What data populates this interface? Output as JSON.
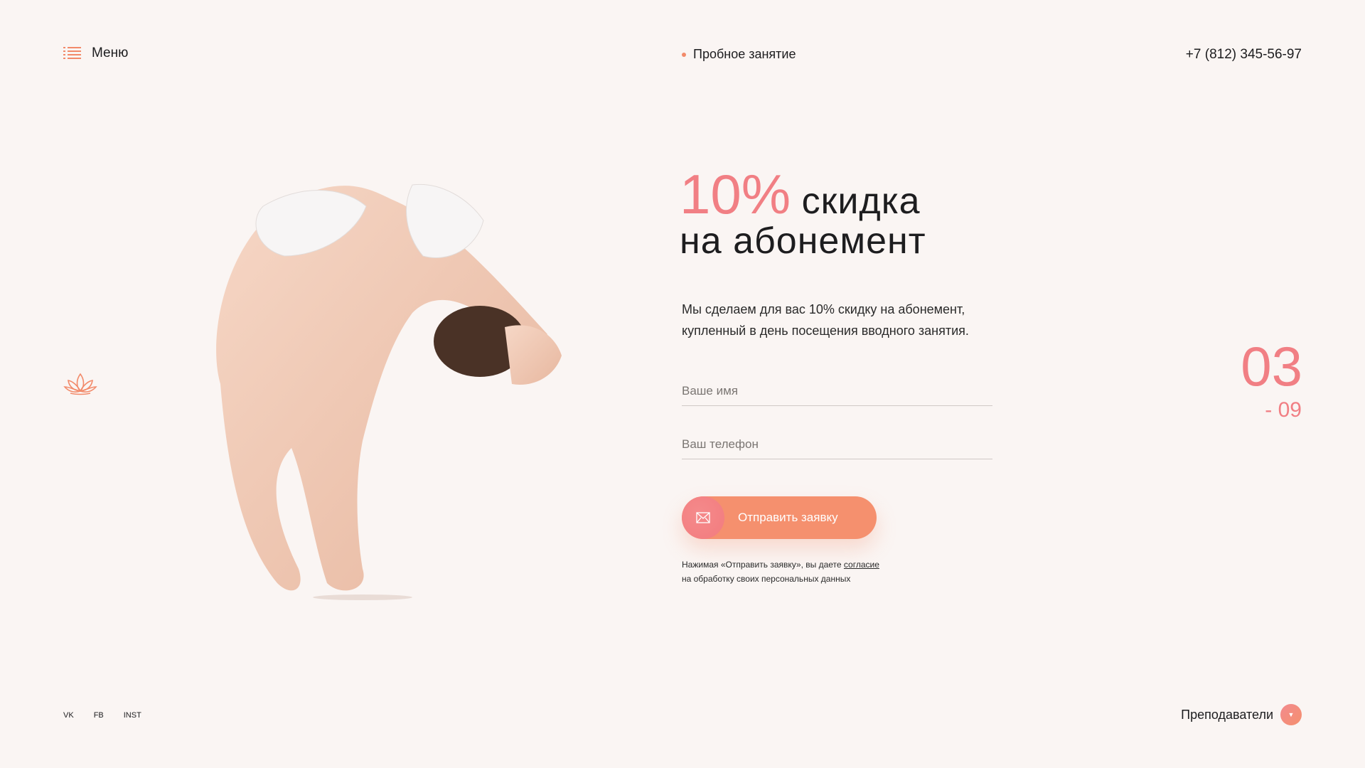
{
  "header": {
    "menu_label": "Меню",
    "trial_label": "Пробное занятие",
    "phone": "+7 (812) 345-56-97"
  },
  "hero": {
    "headline_percent": "10%",
    "headline_rest": "скидка",
    "headline_line2": "на абонемент",
    "description": "Мы сделаем для вас 10% скидку на абонемент, купленный в день посещения вводного занятия."
  },
  "form": {
    "name_placeholder": "Ваше имя",
    "phone_placeholder": "Ваш телефон",
    "submit_label": "Отправить заявку",
    "consent_prefix": "Нажимая «Отправить заявку», вы даете ",
    "consent_link": "согласие",
    "consent_suffix": "на обработку своих персональных данных"
  },
  "pager": {
    "current": "03",
    "total": "- 09"
  },
  "footer": {
    "socials": [
      "VK",
      "FB",
      "INST"
    ],
    "teachers_label": "Преподаватели"
  },
  "colors": {
    "accent": "#f17f84",
    "button": "#f5906e",
    "background": "#faf5f3"
  },
  "icons": {
    "menu": "menu-lines-icon",
    "lotus": "lotus-icon",
    "envelope": "envelope-icon",
    "chevron": "chevron-down-icon"
  }
}
